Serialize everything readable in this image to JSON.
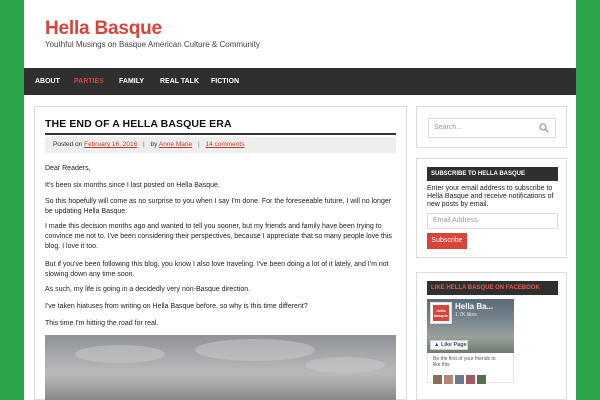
{
  "site": {
    "title": "Hella Basque",
    "description": "Youthful Musings on Basque American Culture & Community"
  },
  "nav": {
    "items": [
      {
        "label": "About",
        "active": false
      },
      {
        "label": "Parties",
        "active": true
      },
      {
        "label": "Family",
        "active": false
      },
      {
        "label": "Real Talk",
        "active": false
      },
      {
        "label": "Fiction",
        "active": false
      }
    ]
  },
  "post": {
    "title": "The End of a Hella Basque Era",
    "meta": {
      "posted_on_prefix": "Posted on",
      "date": "February 16, 2016",
      "by_prefix": "by",
      "author": "Anne Marie",
      "comments": "14 comments"
    },
    "paragraphs": [
      "Dear Readers,",
      "It's been six months since I last posted on Hella Basque.",
      "So this hopefully will come as no surprise to you when I say I'm done. For the foreseeable future, I will no longer be updating Hella Basque.",
      "I made this decision months ago and wanted to tell you sooner, but my friends and family have been trying to convince me not to. I've been considering their perspectives, because I appreciate that so many people love this blog. I love it too.",
      "But if you've been following this blog, you know I also love traveling. I've been doing a lot of it lately, and I'm not slowing down any time soon.",
      "As such, my life is going in a decidedly very non-Basque direction.",
      "I've taken hiatuses from writing on Hella Basque before, so why is this time different?",
      "This time I'm hitting the road for real."
    ]
  },
  "sidebar": {
    "search": {
      "placeholder": "Search..."
    },
    "subscribe": {
      "header": "Subscribe to Hella Basque",
      "text": "Enter your email address to subscribe to Hella Basque and receive notifications of new posts by email.",
      "email_placeholder": "Email Address",
      "button": "Subscribe"
    },
    "facebook": {
      "header": "Like Hella Basque on Facebook",
      "page_name": "Hella Ba...",
      "likes": "1.7K likes",
      "like_button": "Like Page",
      "logo_text": "hella basque",
      "first_text": "Be the first of your friends to like this"
    }
  },
  "colors": {
    "background": "#2aa54a",
    "accent": "#d6443a",
    "navbar": "#2f2f2f"
  }
}
